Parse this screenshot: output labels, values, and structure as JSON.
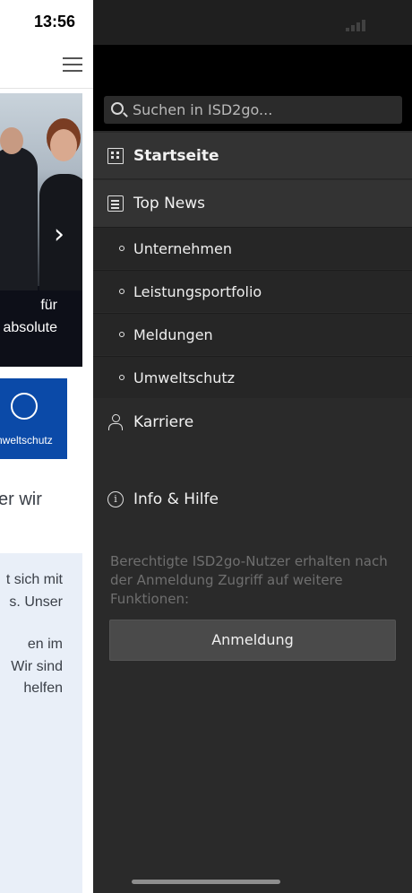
{
  "status_bar": {
    "time": "13:56"
  },
  "background_page": {
    "hero_caption_line1": "für",
    "hero_caption_line2": "absolute",
    "tile_label": "nweltschutz",
    "heading": "er wir",
    "text_para1": [
      "t sich mit",
      "s. Unser"
    ],
    "text_para2": [
      "en im",
      "Wir sind",
      "helfen"
    ]
  },
  "drawer": {
    "search": {
      "placeholder": "Suchen in ISD2go..."
    },
    "items": [
      {
        "label": "Startseite",
        "icon": "building-icon",
        "active": true
      },
      {
        "label": "Top News",
        "icon": "newspaper-icon",
        "expanded": true
      },
      {
        "label": "Karriere",
        "icon": "person-icon"
      },
      {
        "label": "Info & Hilfe",
        "icon": "info-icon"
      }
    ],
    "subitems": [
      {
        "label": "Unternehmen"
      },
      {
        "label": "Leistungsportfolio"
      },
      {
        "label": "Meldungen"
      },
      {
        "label": "Umweltschutz"
      }
    ],
    "notice": "Berechtigte ISD2go-Nutzer erhalten nach der Anmeldung Zugriff auf weitere Funktionen:",
    "login_label": "Anmeldung"
  },
  "colors": {
    "drawer_bg": "#2a2a2a",
    "header_bg": "#000000",
    "active_item_bg": "#333333",
    "tile_blue": "#0b4aa8",
    "textbox_bg": "#e9eff8"
  }
}
